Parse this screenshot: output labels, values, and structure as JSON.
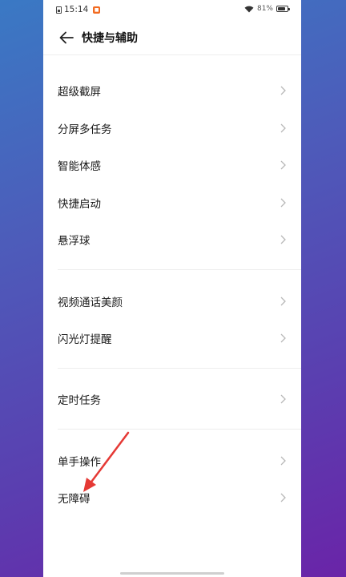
{
  "status_bar": {
    "time": "15:14",
    "battery_percent": "81%",
    "battery_level": 0.81
  },
  "header": {
    "title": "快捷与辅助"
  },
  "sections": [
    {
      "items": [
        {
          "label": "超级截屏"
        },
        {
          "label": "分屏多任务"
        },
        {
          "label": "智能体感"
        },
        {
          "label": "快捷启动"
        },
        {
          "label": "悬浮球"
        }
      ]
    },
    {
      "items": [
        {
          "label": "视频通话美颜"
        },
        {
          "label": "闪光灯提醒"
        }
      ]
    },
    {
      "items": [
        {
          "label": "定时任务"
        }
      ]
    },
    {
      "items": [
        {
          "label": "单手操作"
        },
        {
          "label": "无障碍"
        }
      ]
    }
  ],
  "colors": {
    "annotation": "#e53935",
    "chevron": "#b8b8b8"
  }
}
